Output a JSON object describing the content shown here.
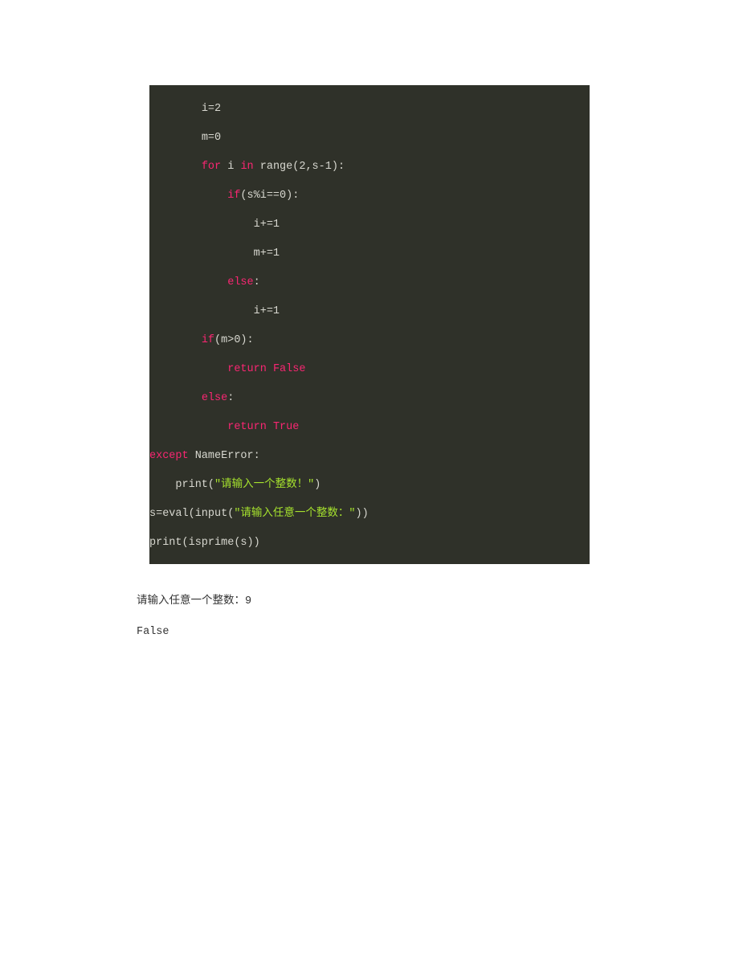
{
  "code": {
    "lines": [
      {
        "indent": "        ",
        "tokens": [
          {
            "t": "i=2",
            "c": ""
          }
        ]
      },
      {
        "indent": "        ",
        "tokens": [
          {
            "t": "m=0",
            "c": ""
          }
        ]
      },
      {
        "indent": "        ",
        "tokens": [
          {
            "t": "for",
            "c": "kw-pink"
          },
          {
            "t": " i ",
            "c": ""
          },
          {
            "t": "in",
            "c": "kw-pink"
          },
          {
            "t": " range(2,s-1):",
            "c": ""
          }
        ]
      },
      {
        "indent": "            ",
        "tokens": [
          {
            "t": "if",
            "c": "kw-pink"
          },
          {
            "t": "(s%i==0):",
            "c": ""
          }
        ]
      },
      {
        "indent": "                ",
        "tokens": [
          {
            "t": "i+=1",
            "c": ""
          }
        ]
      },
      {
        "indent": "                ",
        "tokens": [
          {
            "t": "m+=1",
            "c": ""
          }
        ]
      },
      {
        "indent": "            ",
        "tokens": [
          {
            "t": "else",
            "c": "kw-pink"
          },
          {
            "t": ":",
            "c": ""
          }
        ]
      },
      {
        "indent": "                ",
        "tokens": [
          {
            "t": "i+=1",
            "c": ""
          }
        ]
      },
      {
        "indent": "        ",
        "tokens": [
          {
            "t": "if",
            "c": "kw-pink"
          },
          {
            "t": "(m>0):",
            "c": ""
          }
        ]
      },
      {
        "indent": "            ",
        "tokens": [
          {
            "t": "return",
            "c": "kw-pink"
          },
          {
            "t": " ",
            "c": ""
          },
          {
            "t": "False",
            "c": "kw-pink"
          }
        ]
      },
      {
        "indent": "        ",
        "tokens": [
          {
            "t": "else",
            "c": "kw-pink"
          },
          {
            "t": ":",
            "c": ""
          }
        ]
      },
      {
        "indent": "            ",
        "tokens": [
          {
            "t": "return",
            "c": "kw-pink"
          },
          {
            "t": " ",
            "c": ""
          },
          {
            "t": "True",
            "c": "kw-pink"
          }
        ]
      },
      {
        "indent": "",
        "tokens": [
          {
            "t": "except",
            "c": "kw-pink"
          },
          {
            "t": " NameError:",
            "c": ""
          }
        ]
      },
      {
        "indent": "    ",
        "tokens": [
          {
            "t": "print(",
            "c": ""
          },
          {
            "t": "\"请输入一个整数！\"",
            "c": "kw-green"
          },
          {
            "t": ")",
            "c": ""
          }
        ]
      },
      {
        "indent": "",
        "tokens": [
          {
            "t": "s=eval(input(",
            "c": ""
          },
          {
            "t": "\"请输入任意一个整数：\"",
            "c": "kw-green"
          },
          {
            "t": "))",
            "c": ""
          }
        ]
      },
      {
        "indent": "",
        "tokens": [
          {
            "t": "print(isprime(s))",
            "c": ""
          }
        ]
      }
    ]
  },
  "output": {
    "line1": "请输入任意一个整数：9",
    "line2": "False"
  }
}
